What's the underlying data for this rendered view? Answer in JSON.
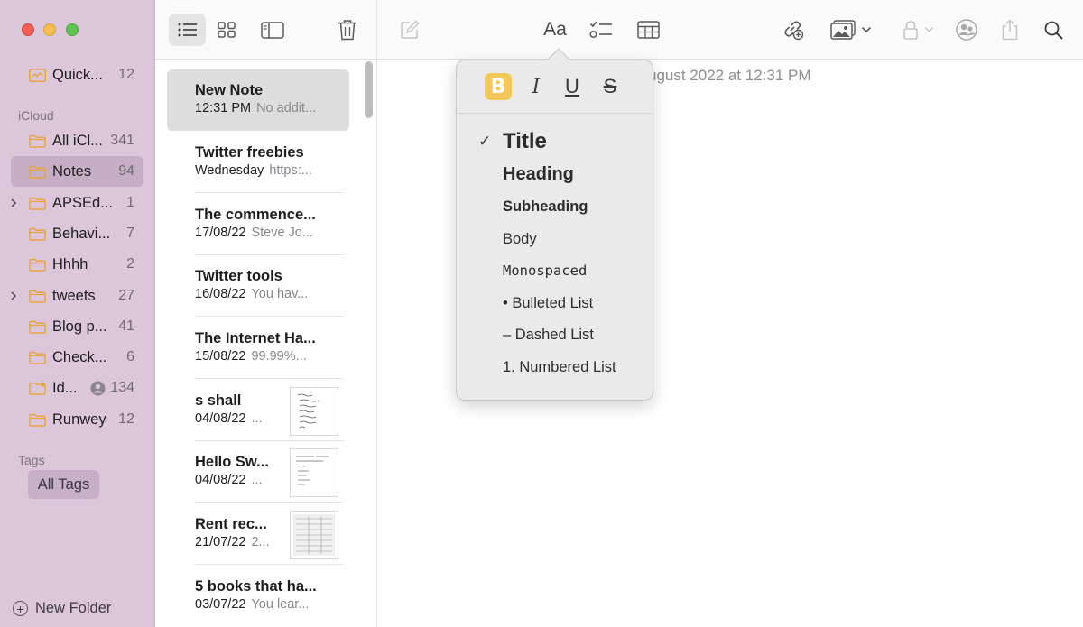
{
  "sidebar": {
    "quick_notes": {
      "label": "Quick...",
      "count": "12"
    },
    "section_icloud": "iCloud",
    "folders": [
      {
        "label": "All iCl...",
        "count": "341"
      },
      {
        "label": "Notes",
        "count": "94"
      },
      {
        "label": "APSEd...",
        "count": "1"
      },
      {
        "label": "Behavi...",
        "count": "7"
      },
      {
        "label": "Hhhh",
        "count": "2"
      },
      {
        "label": "tweets",
        "count": "27"
      },
      {
        "label": "Blog p...",
        "count": "41"
      },
      {
        "label": "Check...",
        "count": "6"
      },
      {
        "label": "Id...",
        "count": "134"
      },
      {
        "label": "Runwey",
        "count": "12"
      }
    ],
    "section_tags": "Tags",
    "all_tags": "All Tags",
    "new_folder": "New Folder"
  },
  "notes": [
    {
      "title": "New Note",
      "date": "12:31 PM",
      "preview": "No addit..."
    },
    {
      "title": "Twitter freebies",
      "date": "Wednesday",
      "preview": "https:..."
    },
    {
      "title": "The commence...",
      "date": "17/08/22",
      "preview": "Steve Jo..."
    },
    {
      "title": "Twitter tools",
      "date": "16/08/22",
      "preview": "You hav..."
    },
    {
      "title": "The Internet Ha...",
      "date": "15/08/22",
      "preview": "99.99%..."
    },
    {
      "title": "s shall",
      "date": "04/08/22",
      "preview": "..."
    },
    {
      "title": "Hello Sw...",
      "date": "04/08/22",
      "preview": "..."
    },
    {
      "title": "Rent rec...",
      "date": "21/07/22",
      "preview": "2..."
    },
    {
      "title": "5 books that ha...",
      "date": "03/07/22",
      "preview": "You lear..."
    }
  ],
  "editor": {
    "date_text": "ugust 2022 at 12:31 PM"
  },
  "format_popover": {
    "bold": "B",
    "italic": "I",
    "underline": "U",
    "strike": "S",
    "checkmark": "✓",
    "styles": {
      "title": "Title",
      "heading": "Heading",
      "subheading": "Subheading",
      "body": "Body",
      "mono": "Monospaced",
      "bulleted": "• Bulleted List",
      "dashed": "– Dashed List",
      "numbered": "1. Numbered List"
    }
  },
  "toolbar": {
    "format_label": "Aa"
  },
  "colors": {
    "sidebar_bg": "#dcc6da",
    "folder_icon": "#e8a33b",
    "highlight": "#f3c75a"
  }
}
